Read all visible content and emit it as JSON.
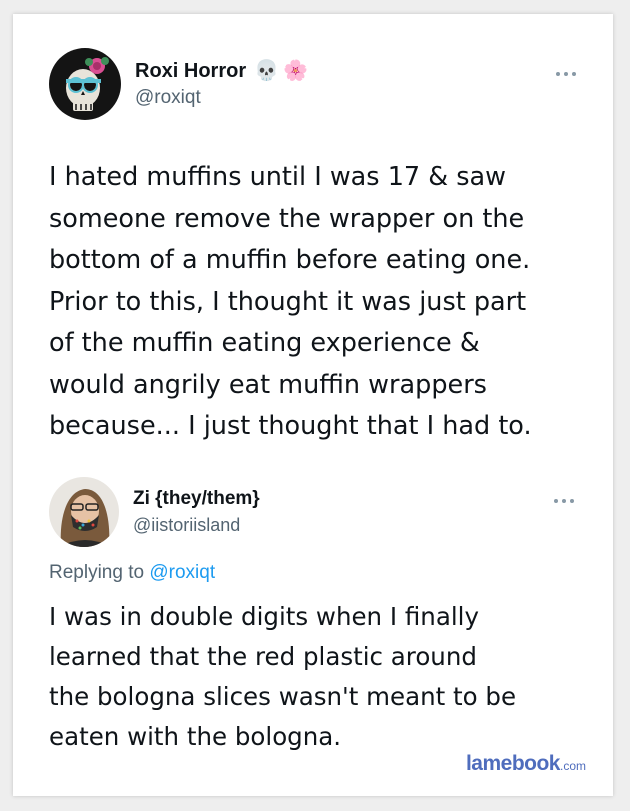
{
  "tweet": {
    "author": {
      "name": "Roxi Horror",
      "handle": "@roxiqt",
      "emojis": [
        "💀",
        "🌸"
      ]
    },
    "text": "I hated muffins until I was 17 & saw\nsomeone remove the wrapper on the\nbottom of a muffin before eating one.\nPrior to this, I thought it was just part\nof the muffin eating experience &\nwould angrily eat muffin wrappers\nbecause... I just thought that I had to."
  },
  "reply": {
    "author": {
      "name": "Zi {they/them}",
      "handle": "@iistoriisland"
    },
    "replying_label": "Replying to",
    "replying_to": "@roxiqt",
    "text": "I was in double digits when I finally\nlearned that the red plastic around\nthe bologna slices wasn't meant to be\neaten with the bologna."
  },
  "watermark": {
    "name": "lamebook",
    "suffix": ".com"
  },
  "colors": {
    "text": "#0f1419",
    "secondary": "#536471",
    "link": "#1d9bf0",
    "watermark": "#4f6dbd"
  }
}
